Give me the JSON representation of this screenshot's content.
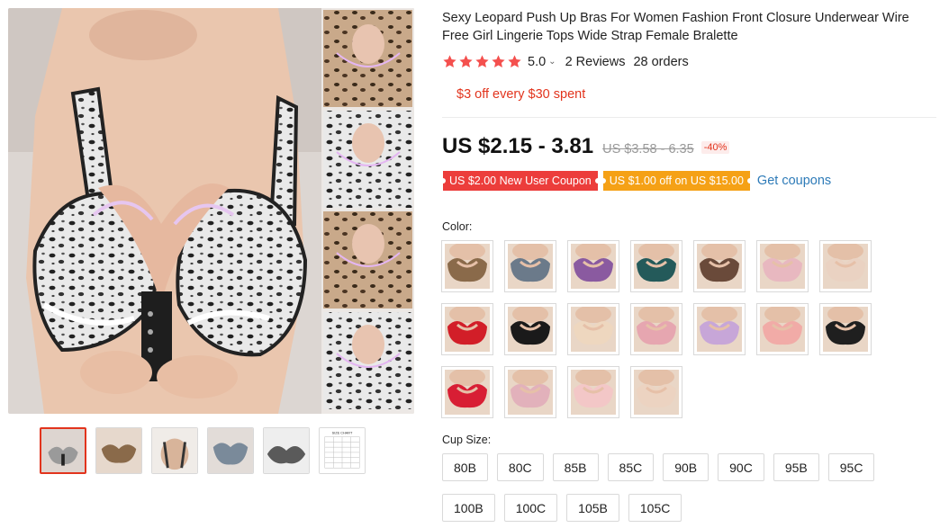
{
  "product": {
    "title": "Sexy Leopard Push Up Bras For Women Fashion Front Closure Underwear Wire Free Girl Lingerie Tops Wide Strap Female Bralette",
    "rating": 5.0,
    "rating_label": "5.0",
    "reviews_label": "2 Reviews",
    "orders_label": "28 orders",
    "promo": "$3 off every $30 spent",
    "price": "US $2.15 - 3.81",
    "original_price": "US $3.58 - 6.35",
    "discount": "-40%",
    "coupons": [
      {
        "label": "US $2.00 New User Coupon",
        "color": "#ec3d3b"
      },
      {
        "label": "US $1.00 off on US $15.00",
        "color": "#f5a116"
      }
    ],
    "get_coupons_label": "Get coupons"
  },
  "gallery": {
    "thumbnails": [
      {
        "name": "thumb-1",
        "active": true
      },
      {
        "name": "thumb-2",
        "active": false
      },
      {
        "name": "thumb-3",
        "active": false
      },
      {
        "name": "thumb-4",
        "active": false
      },
      {
        "name": "thumb-5",
        "active": false
      },
      {
        "name": "size-chart",
        "active": false
      }
    ],
    "size_chart_text": "SIZE CHART"
  },
  "color_section": {
    "label": "Color:",
    "swatches": [
      "#8a6a4a",
      "#6b7a8a",
      "#8a5aa0",
      "#245a5a",
      "#6a4a3a",
      "#e8b8c0",
      "#ead2c2",
      "#d21e28",
      "#1a1a1a",
      "#eed7bf",
      "#e6a6b0",
      "#c7a6d8",
      "#f1aba7",
      "#1f1f1f",
      "#d81e34",
      "#e2b1bb",
      "#f3c7c7",
      "#ecd3c1"
    ]
  },
  "cup_size": {
    "label": "Cup Size:",
    "options": [
      "80B",
      "80C",
      "85B",
      "85C",
      "90B",
      "90C",
      "95B",
      "95C",
      "100B",
      "100C",
      "105B",
      "105C"
    ]
  },
  "colors": {
    "accent": "#e2341d",
    "star": "#f4504e",
    "link": "#2e7bb8"
  }
}
